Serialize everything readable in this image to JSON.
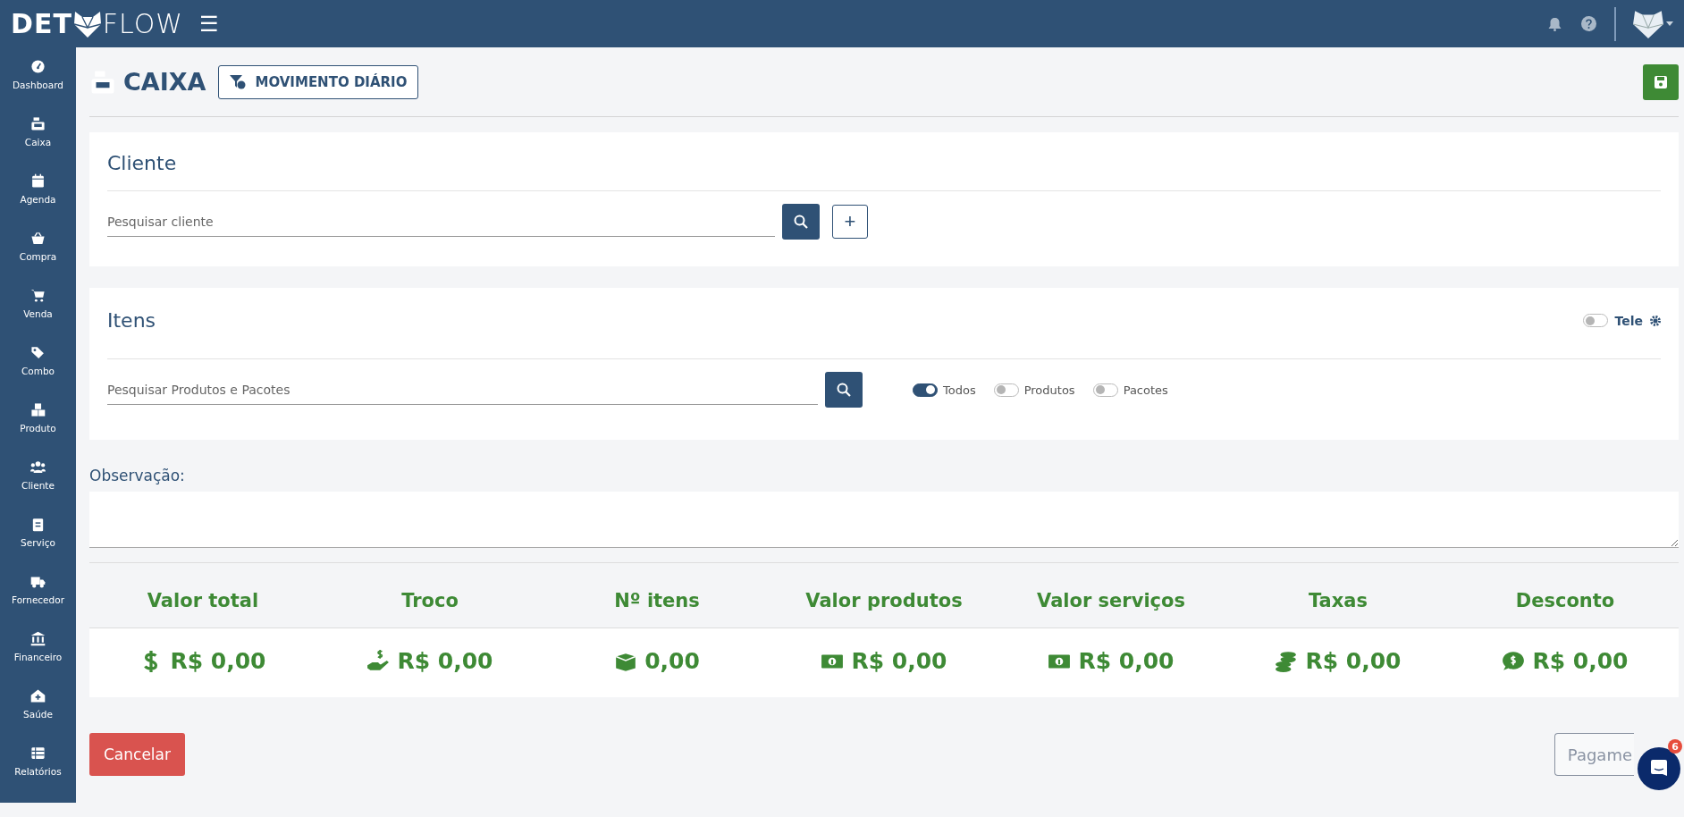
{
  "topbar": {
    "logo_left": "DET",
    "logo_right": "FLOW",
    "menu_icon": "☰"
  },
  "sidebar": {
    "items": [
      {
        "label": "Dashboard"
      },
      {
        "label": "Caixa"
      },
      {
        "label": "Agenda"
      },
      {
        "label": "Compra"
      },
      {
        "label": "Venda"
      },
      {
        "label": "Combo"
      },
      {
        "label": "Produto"
      },
      {
        "label": "Cliente"
      },
      {
        "label": "Serviço"
      },
      {
        "label": "Fornecedor"
      },
      {
        "label": "Financeiro"
      },
      {
        "label": "Saúde"
      },
      {
        "label": "Relatórios"
      }
    ]
  },
  "header": {
    "title": "CAIXA",
    "button": "MOVIMENTO DIÁRIO"
  },
  "cliente": {
    "title": "Cliente",
    "search": {
      "placeholder": "Pesquisar cliente"
    },
    "add_button": "+"
  },
  "itens": {
    "title": "Itens",
    "tele": {
      "label": "Tele",
      "on": false
    },
    "search": {
      "placeholder": "Pesquisar Produtos e Pacotes"
    },
    "filters": [
      {
        "label": "Todos",
        "on": true
      },
      {
        "label": "Produtos",
        "on": false
      },
      {
        "label": "Pacotes",
        "on": false
      }
    ]
  },
  "observacao": {
    "label": "Observação:"
  },
  "totals": [
    {
      "label": "Valor total",
      "value": "R$ 0,00"
    },
    {
      "label": "Troco",
      "value": "R$ 0,00"
    },
    {
      "label": "Nº itens",
      "value": "0,00"
    },
    {
      "label": "Valor produtos",
      "value": "R$ 0,00"
    },
    {
      "label": "Valor serviços",
      "value": "R$ 0,00"
    },
    {
      "label": "Taxas",
      "value": "R$ 0,00"
    },
    {
      "label": "Desconto",
      "value": "R$ 0,00"
    }
  ],
  "footer": {
    "cancel": "Cancelar",
    "pay": "Pagame",
    "pay_disabled": true
  },
  "chat": {
    "badge": "6"
  }
}
